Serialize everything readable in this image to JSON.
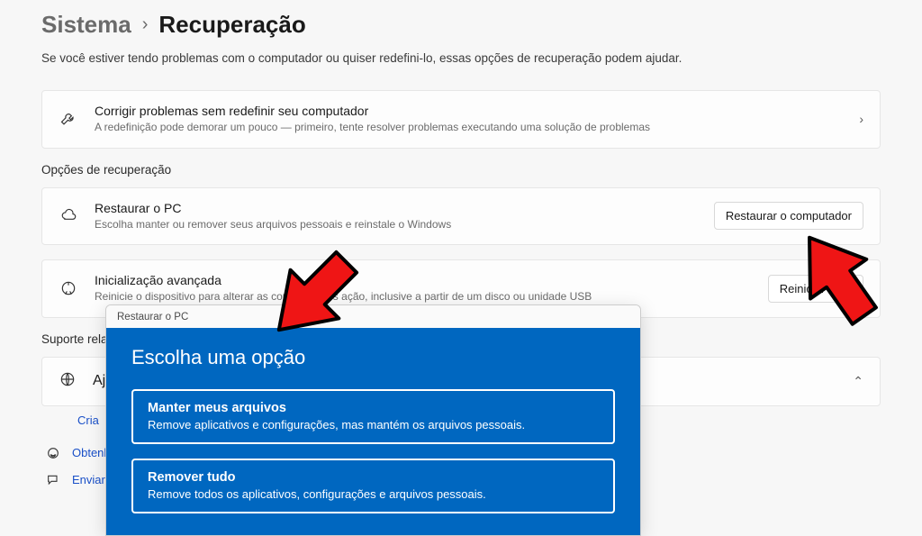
{
  "breadcrumb": {
    "parent": "Sistema",
    "sep": "›",
    "current": "Recuperação"
  },
  "subtitle": "Se você estiver tendo problemas com o computador ou quiser redefini-lo, essas opções de recuperação podem ajudar.",
  "fix_card": {
    "title": "Corrigir problemas sem redefinir seu computador",
    "desc": "A redefinição pode demorar um pouco — primeiro, tente resolver problemas executando uma solução de problemas"
  },
  "section_recovery": "Opções de recuperação",
  "reset_card": {
    "title": "Restaurar o PC",
    "desc": "Escolha manter ou remover seus arquivos pessoais e reinstale o Windows",
    "button": "Restaurar o computador"
  },
  "advanced_card": {
    "title": "Inicialização avançada",
    "desc": "Reinicie o dispositivo para alterar as configurações                         ação, inclusive a partir de um disco ou unidade USB",
    "button": "Reiniciar agor"
  },
  "section_support": "Suporte rela",
  "support_row": {
    "title": "Aju"
  },
  "create_link": "Cria",
  "link_help": "Obtenha",
  "link_feedback": "Enviar c",
  "dialog": {
    "titlebar": "Restaurar o PC",
    "heading": "Escolha uma opção",
    "keep": {
      "title": "Manter meus arquivos",
      "desc": "Remove aplicativos e configurações, mas mantém os arquivos pessoais."
    },
    "remove": {
      "title": "Remover tudo",
      "desc": "Remove todos os aplicativos, configurações e arquivos pessoais."
    }
  }
}
